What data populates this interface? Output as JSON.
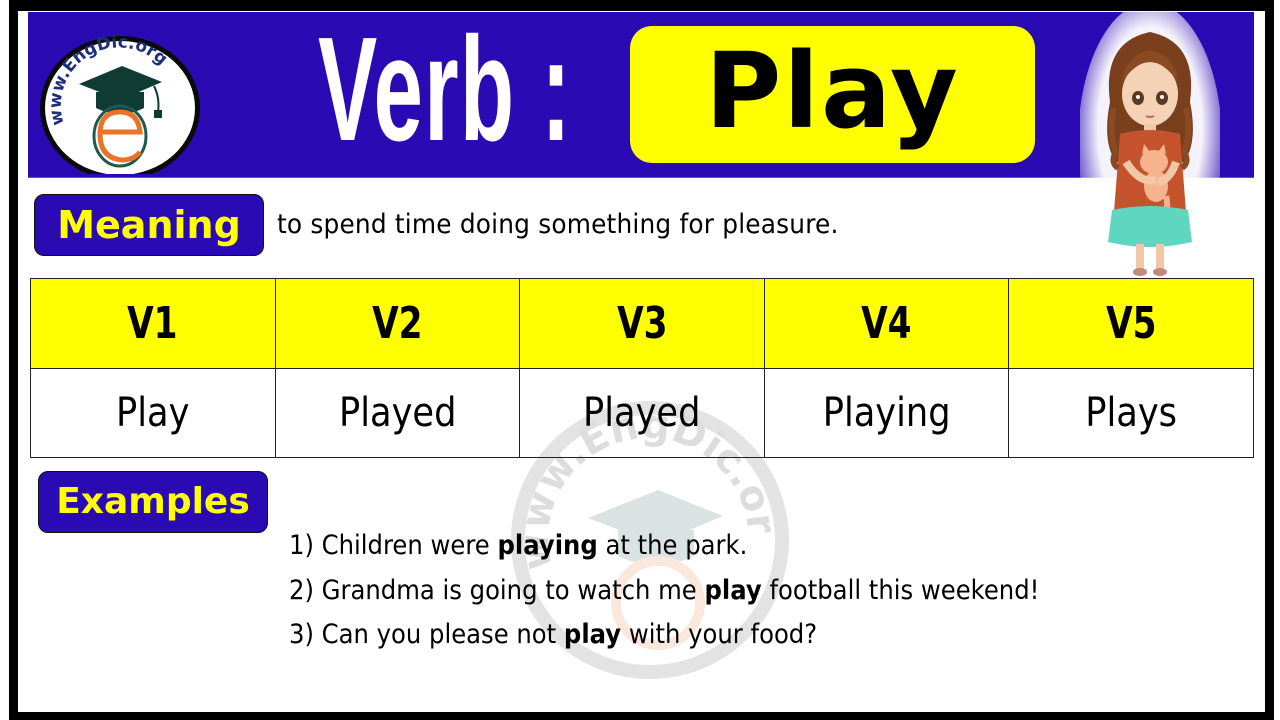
{
  "header": {
    "logo": {
      "icon": "engdic-logo-icon",
      "text": "www.EngDic.org"
    },
    "verb_label": "Verb :",
    "word": "Play",
    "illustration": "girl-holding-cat-illustration",
    "colors": {
      "banner": "#2a0ab3",
      "word_box": "#ffff00",
      "label_text": "#ffff00"
    }
  },
  "meaning": {
    "label": "Meaning",
    "text": "to spend time doing something for pleasure."
  },
  "forms_table": {
    "headers": [
      "V1",
      "V2",
      "V3",
      "V4",
      "V5"
    ],
    "values": [
      "Play",
      "Played",
      "Played",
      "Playing",
      "Plays"
    ]
  },
  "examples": {
    "label": "Examples",
    "items": [
      {
        "num": "1)",
        "before": "Children were",
        "bold": "playing",
        "after": "at the park."
      },
      {
        "num": "2)",
        "before": "Grandma is going to watch me",
        "bold": "play",
        "after": "football this weekend!"
      },
      {
        "num": "3)",
        "before": "Can you please not",
        "bold": "play",
        "after": "with your food?"
      }
    ]
  },
  "watermark": {
    "icon": "engdic-watermark-icon",
    "text": "www.EngDic.org"
  }
}
